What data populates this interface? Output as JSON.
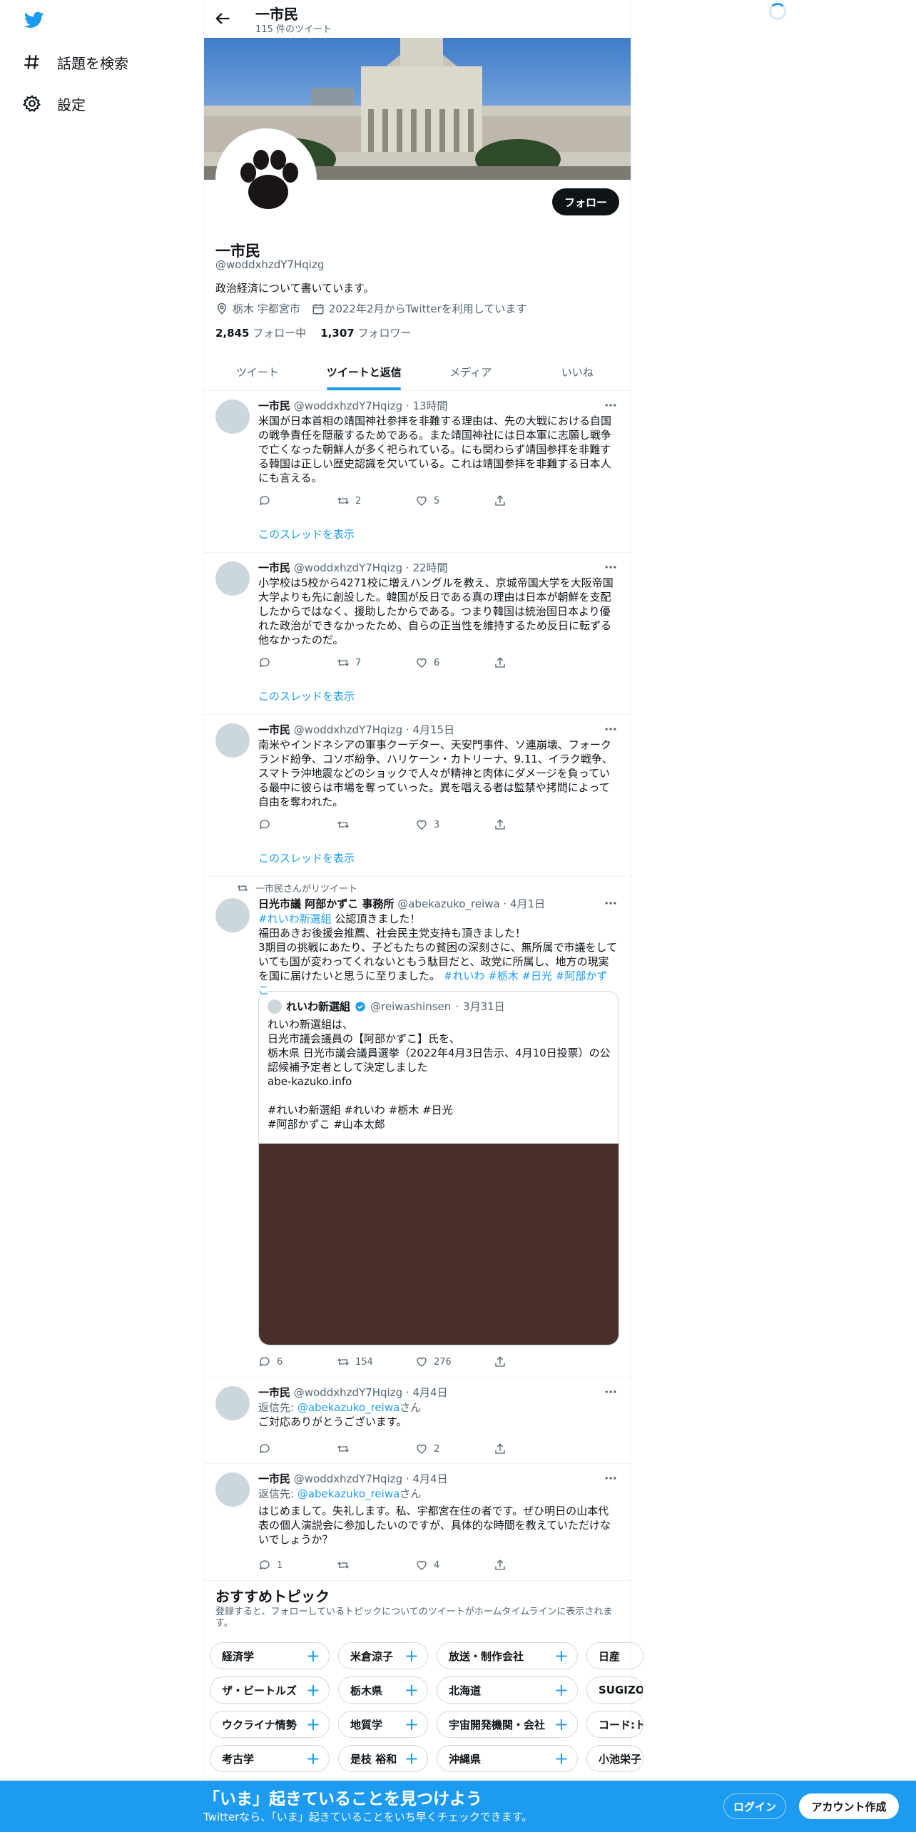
{
  "nav": {
    "items": [
      {
        "label": "話題を検索",
        "icon": "hashtag-icon"
      },
      {
        "label": "設定",
        "icon": "gear-icon"
      }
    ]
  },
  "header": {
    "title": "一市民",
    "tweet_count": "115 件のツイート"
  },
  "profile": {
    "name": "一市民",
    "handle": "@woddxhzdY7Hqizg",
    "bio": "政治経済について書いています。",
    "location": "栃木 宇都宮市",
    "joined": "2022年2月からTwitterを利用しています",
    "following_count": "2,845",
    "following_label": "フォロー中",
    "followers_count": "1,307",
    "followers_label": "フォロワー",
    "follow_button": "フォロー"
  },
  "tabs": [
    "ツイート",
    "ツイートと返信",
    "メディア",
    "いいね"
  ],
  "thread_link": "このスレッドを表示",
  "tweets": [
    {
      "name": "一市民",
      "handle": "@woddxhzdY7Hqizg",
      "time": "13時間",
      "text": "米国が日本首相の靖国神社参拝を非難する理由は、先の大戦における自国の戦争責任を隠蔽するためである。また靖国神社には日本軍に志願し戦争で亡くなった朝鮮人が多く祀られている。にも関わらず靖国参拝を非難する韓国は正しい歴史認識を欠いている。これは靖国参拝を非難する日本人にも言える。",
      "retweets": "2",
      "likes": "5"
    },
    {
      "name": "一市民",
      "handle": "@woddxhzdY7Hqizg",
      "time": "22時間",
      "text": "小学校は5校から4271校に増えハングルを教え、京城帝国大学を大阪帝国大学よりも先に創設した。韓国が反日である真の理由は日本が朝鮮を支配したからではなく、援助したからである。つまり韓国は統治国日本より優れた政治ができなかったため、自らの正当性を維持するため反日に転ずる他なかったのだ。",
      "retweets": "7",
      "likes": "6"
    },
    {
      "name": "一市民",
      "handle": "@woddxhzdY7Hqizg",
      "time": "4月15日",
      "text": "南米やインドネシアの軍事クーデター、天安門事件、ソ連崩壊、フォークランド紛争、コソボ紛争、ハリケーン・カトリーナ、9.11、イラク戦争、スマトラ沖地震などのショックで人々が精神と肉体にダメージを負っている最中に彼らは市場を奪っていった。異を唱える者は監禁や拷問によって自由を奪われた。",
      "retweets": "",
      "likes": "3"
    }
  ],
  "retweet": {
    "social_context": "一市民さんがリツイート",
    "name": "日光市議 阿部かずこ 事務所",
    "handle": "@abekazuko_reiwa",
    "time": "4月1日",
    "line1_tag": "#れいわ新選組",
    "line1_text": " 公認頂きました！",
    "line2": "福田あきお後援会推薦、社会民主党支持も頂きました！",
    "line3": "3期目の挑戦にあたり、子どもたちの貧困の深刻さに、無所属で市議をしていても国が変わってくれないともう駄目だと、政党に所属し、地方の現実を国に届けたいと思うに至りました。",
    "line3_tags": "#れいわ #栃木 #日光 #阿部かずこ",
    "quote": {
      "name": "れいわ新選組",
      "handle": "@reiwashinsen",
      "time": "3月31日",
      "text": "れいわ新選組は、\n日光市議会議員の【阿部かずこ】氏を、\n栃木県 日光市議会議員選挙（2022年4月3日告示、4月10日投票）の公認候補予定者として決定しました\nabe-kazuko.info\n\n#れいわ新選組 #れいわ #栃木 #日光\n#阿部かずこ #山本太郎"
    },
    "replies": "6",
    "retweets": "154",
    "likes": "276"
  },
  "replies": [
    {
      "name": "一市民",
      "handle": "@woddxhzdY7Hqizg",
      "time": "4月4日",
      "reply_to_label": "返信先: ",
      "reply_to": "@abekazuko_reiwa",
      "reply_suffix": "さん",
      "text": "ご対応ありがとうございます。",
      "replies": "",
      "likes": "2"
    },
    {
      "name": "一市民",
      "handle": "@woddxhzdY7Hqizg",
      "time": "4月4日",
      "reply_to_label": "返信先: ",
      "reply_to": "@abekazuko_reiwa",
      "reply_suffix": "さん",
      "text": "はじめまして。失礼します。私、宇都宮在住の者です。ぜひ明日の山本代表の個人演説会に参加したいのですが、具体的な時間を教えていただけないでしょうか？",
      "replies": "1",
      "likes": "4"
    }
  ],
  "topics": {
    "title": "おすすめトピック",
    "description": "登録すると、フォローしているトピックについてのツイートがホームタイムラインに表示されます。",
    "rows": [
      [
        "経済学",
        "米倉涼子",
        "放送・制作会社",
        "日産"
      ],
      [
        "ザ・ビートルズ",
        "栃木県",
        "北海道",
        "SUGIZO"
      ],
      [
        "ウクライナ情勢",
        "地質学",
        "宇宙開発機関・会社",
        "コード:ト"
      ],
      [
        "考古学",
        "是枝 裕和",
        "沖縄県",
        "小池栄子"
      ]
    ]
  },
  "bottom_bar": {
    "headline": "「いま」起きていることを見つけよう",
    "subtext": "Twitterなら、「いま」起きていることをいち早くチェックできます。",
    "login": "ログイン",
    "signup": "アカウント作成"
  },
  "colors": {
    "accent": "#1d9bf0",
    "text": "#0f1419",
    "muted": "#536471"
  }
}
